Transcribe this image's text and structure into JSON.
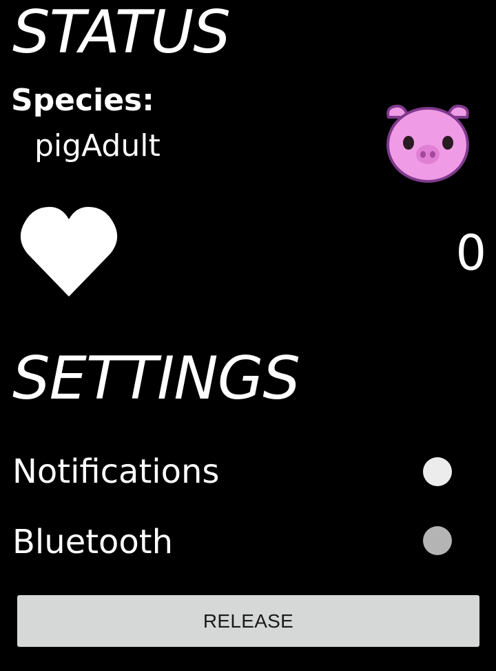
{
  "status": {
    "title": "STATUS",
    "species_label": "Species:",
    "species_value": "pigAdult",
    "avatar_icon": "pig-face-icon",
    "avatar_color": "#f09be6",
    "love_icon": "heart-icon",
    "love_count": "0"
  },
  "settings": {
    "title": "SETTINGS",
    "items": [
      {
        "label": "Notifications",
        "toggle_color": "#ececec"
      },
      {
        "label": "Bluetooth",
        "toggle_color": "#b4b4b4"
      }
    ]
  },
  "actions": {
    "release_label": "RELEASE"
  },
  "colors": {
    "background": "#000000",
    "text": "#ffffff",
    "button_bg": "#d6d7d7",
    "button_text": "#1a1a1a"
  }
}
